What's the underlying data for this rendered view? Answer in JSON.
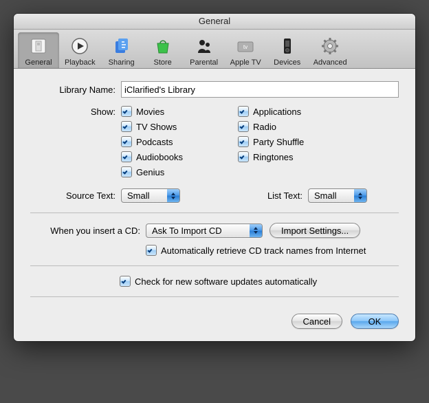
{
  "window": {
    "title": "General"
  },
  "toolbar": {
    "items": [
      {
        "label": "General"
      },
      {
        "label": "Playback"
      },
      {
        "label": "Sharing"
      },
      {
        "label": "Store"
      },
      {
        "label": "Parental"
      },
      {
        "label": "Apple TV"
      },
      {
        "label": "Devices"
      },
      {
        "label": "Advanced"
      }
    ]
  },
  "form": {
    "library_name_label": "Library Name:",
    "library_name_value": "iClarified's Library",
    "show_label": "Show:",
    "show_left": [
      "Movies",
      "TV Shows",
      "Podcasts",
      "Audiobooks",
      "Genius"
    ],
    "show_right": [
      "Applications",
      "Radio",
      "Party Shuffle",
      "Ringtones"
    ],
    "source_text_label": "Source Text:",
    "source_text_value": "Small",
    "list_text_label": "List Text:",
    "list_text_value": "Small",
    "cd_label": "When you insert a CD:",
    "cd_value": "Ask To Import CD",
    "import_settings_btn": "Import Settings...",
    "auto_retrieve": "Automatically retrieve CD track names from Internet",
    "check_updates": "Check for new software updates automatically"
  },
  "buttons": {
    "cancel": "Cancel",
    "ok": "OK"
  }
}
